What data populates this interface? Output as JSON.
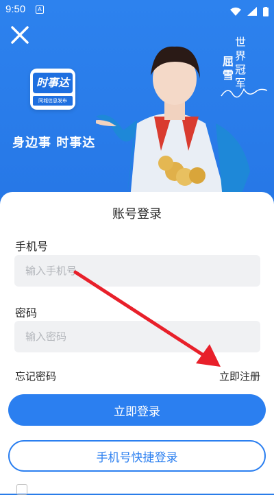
{
  "status_bar": {
    "time": "9:50",
    "notification_badge": "A"
  },
  "banner": {
    "logo_main": "时事达",
    "logo_sub": "同城信息发布",
    "slogan": "身边事  时事达",
    "champion_title": "世界冠军",
    "champion_name": "屈雪"
  },
  "login": {
    "title": "账号登录",
    "phone_label": "手机号",
    "phone_placeholder": "输入手机号",
    "password_label": "密码",
    "password_placeholder": "输入密码",
    "forgot_password": "忘记密码",
    "register": "立即注册",
    "login_button": "立即登录",
    "quick_login_button": "手机号快捷登录"
  },
  "colors": {
    "brand_blue": "#2b7ff0",
    "annotation_red": "#e8202a"
  }
}
